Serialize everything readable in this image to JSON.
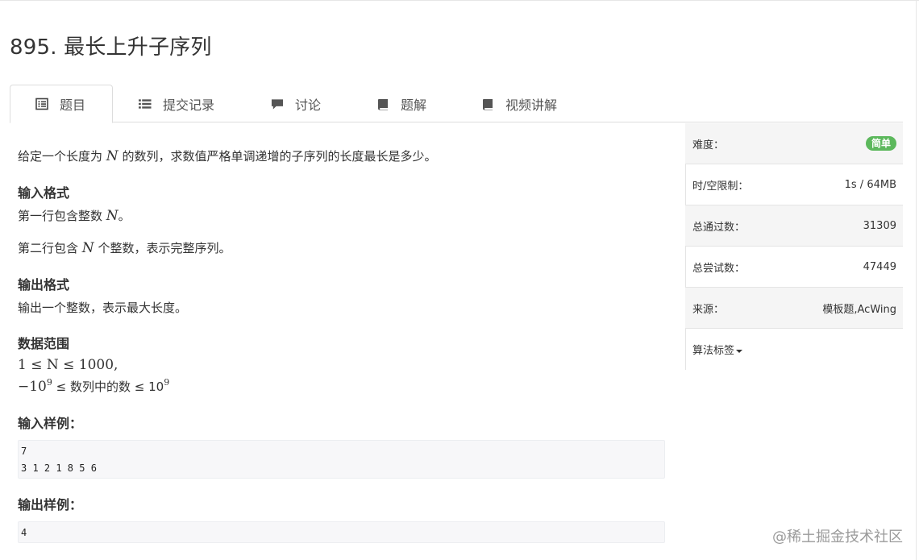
{
  "title": "895. 最长上升子序列",
  "tabs": [
    {
      "label": "题目",
      "icon": "list-alt-icon"
    },
    {
      "label": "提交记录",
      "icon": "list-icon"
    },
    {
      "label": "讨论",
      "icon": "comment-icon"
    },
    {
      "label": "题解",
      "icon": "book-icon"
    },
    {
      "label": "视频讲解",
      "icon": "book-icon"
    }
  ],
  "problem": {
    "intro_pre": "给定一个长度为",
    "intro_var": "N",
    "intro_post": "的数列，求数值严格单调递增的子序列的长度最长是多少。",
    "input_heading": "输入格式",
    "input_line1_pre": "第一行包含整数",
    "input_line1_var": "N",
    "input_line1_post": "。",
    "input_line2_pre": "第二行包含",
    "input_line2_var": "N",
    "input_line2_post": "个整数，表示完整序列。",
    "output_heading": "输出格式",
    "output_line": "输出一个整数，表示最大长度。",
    "range_heading": "数据范围",
    "range_line1": "1 ≤ N ≤ 1000,",
    "range_line2_pre": "−10",
    "range_line2_exp": "9",
    "range_line2_mid": "≤ 数列中的数 ≤ 10",
    "range_line2_exp2": "9",
    "sample_input_heading": "输入样例：",
    "sample_input": [
      "7",
      "3 1 2 1 8 5 6"
    ],
    "sample_output_heading": "输出样例：",
    "sample_output": [
      "4"
    ]
  },
  "sidebar": {
    "difficulty_label": "难度：",
    "difficulty_value": "简单",
    "limit_label": "时/空限制：",
    "limit_value": "1s / 64MB",
    "passed_label": "总通过数：",
    "passed_value": "31309",
    "tried_label": "总尝试数：",
    "tried_value": "47449",
    "source_label": "来源：",
    "source_value": "模板题,AcWing",
    "tags_label": "算法标签"
  },
  "watermark": "@稀土掘金技术社区",
  "colors": {
    "badge": "#5cb85c",
    "text": "#333333",
    "codebg": "#f7f7f9"
  }
}
